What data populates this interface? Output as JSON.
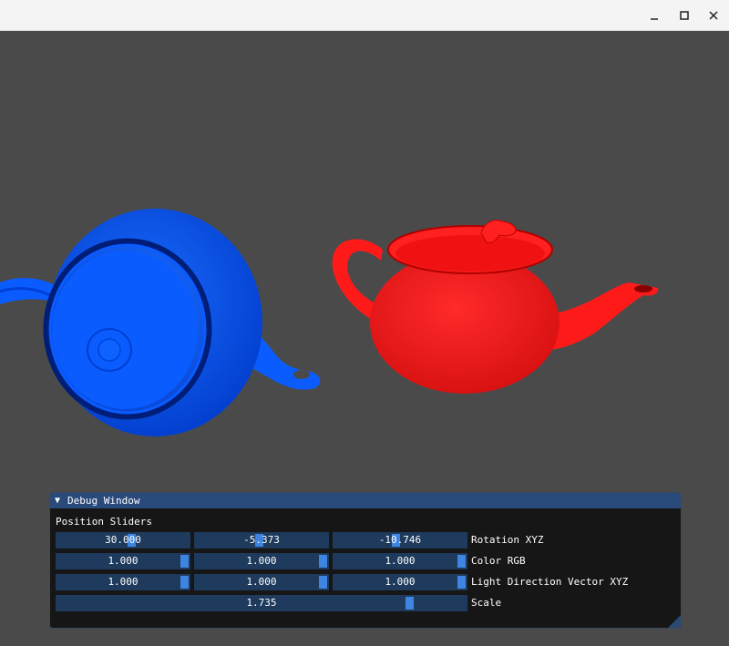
{
  "window": {
    "minimize_icon": "minimize-icon",
    "maximize_icon": "maximize-icon",
    "close_icon": "close-icon"
  },
  "scene": {
    "background": "#4a4a4a",
    "objects": [
      {
        "name": "teapot",
        "color": "#0a5cff"
      },
      {
        "name": "teapot",
        "color": "#ff1a1a"
      }
    ]
  },
  "debug_window": {
    "title": "Debug Window",
    "collapse_icon": "triangle-down-icon",
    "section_label": "Position Sliders",
    "rows": [
      {
        "label": "Rotation XYZ",
        "values": [
          "30.000",
          "-5.373",
          "-10.746"
        ],
        "fractions": [
          0.57,
          0.48,
          0.47
        ]
      },
      {
        "label": "Color RGB",
        "values": [
          "1.000",
          "1.000",
          "1.000"
        ],
        "fractions": [
          1.0,
          1.0,
          1.0
        ]
      },
      {
        "label": "Light Direction Vector XYZ",
        "values": [
          "1.000",
          "1.000",
          "1.000"
        ],
        "fractions": [
          1.0,
          1.0,
          1.0
        ]
      },
      {
        "label": "Scale",
        "values": [
          "1.735"
        ],
        "fractions": [
          0.87
        ]
      }
    ]
  }
}
